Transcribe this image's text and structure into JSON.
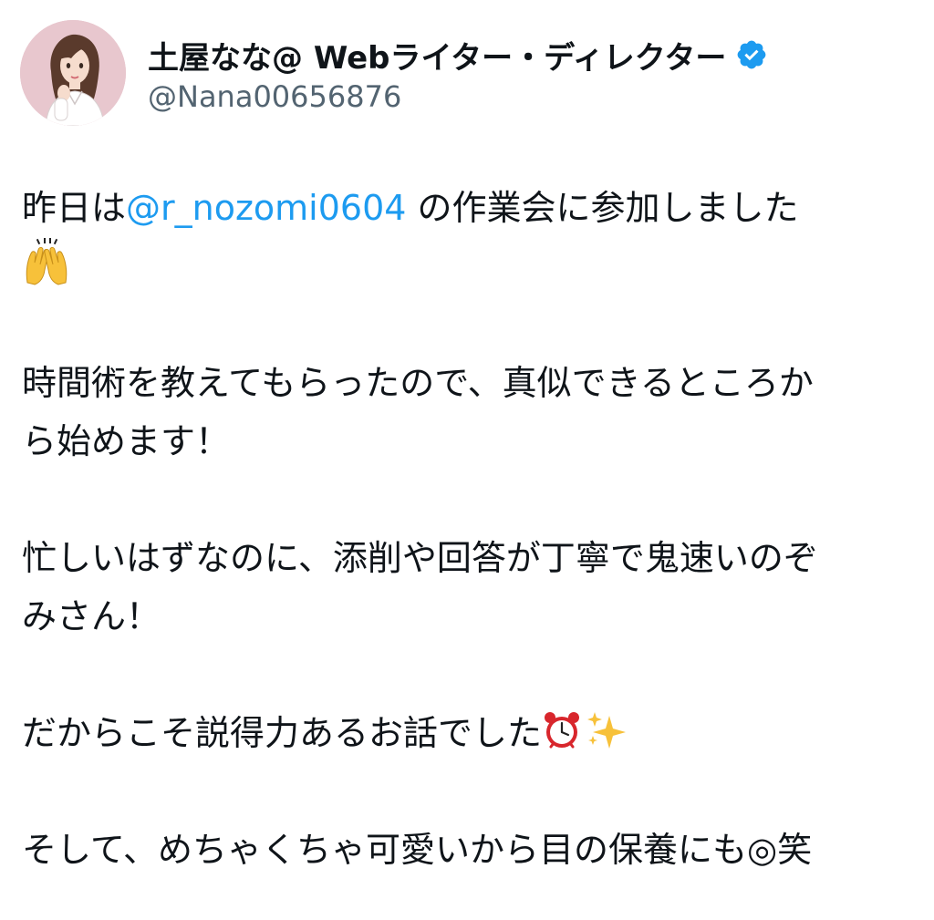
{
  "profile": {
    "display_name": "土屋なな@ Webライター・ディレクター",
    "handle": "@Nana00656876",
    "verified": true,
    "avatar_icon": "profile-avatar",
    "verified_icon": "verified-badge-icon",
    "verified_color": "#1d9bf0"
  },
  "tweet": {
    "p1_prefix": "昨日は",
    "p1_mention": "@r_nozomi0604",
    "p1_suffix": " の作業会に参加しました",
    "p1_emoji": "raising-hands-emoji",
    "p2_line1": "時間術を教えてもらったので、真似できるところか",
    "p2_line2": "ら始めます！",
    "p3_line1": "忙しいはずなのに、添削や回答が丁寧で鬼速いのぞ",
    "p3_line2": "みさん！",
    "p4_text": "だからこそ説得力あるお話でした",
    "p4_emoji1": "alarm-clock-emoji",
    "p4_emoji2": "sparkles-emoji",
    "p5_text": "そして、めちゃくちゃ可愛いから目の保養にも◎笑"
  },
  "colors": {
    "text": "#0f1419",
    "secondary": "#536471",
    "link": "#1d9bf0"
  }
}
